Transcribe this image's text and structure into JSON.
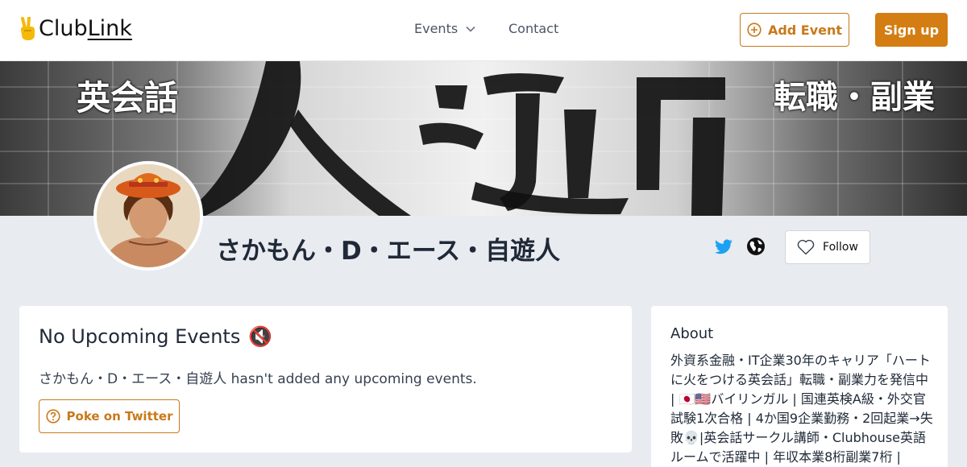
{
  "header": {
    "logo_prefix": "Club",
    "logo_suffix": "Link",
    "nav_events": "Events",
    "nav_contact": "Contact",
    "add_event": "Add Event",
    "sign_up": "Sign up"
  },
  "banner": {
    "left_text": "英会話",
    "right_text": "転職・副業"
  },
  "profile": {
    "name": "さかもん・D・エース・自遊人",
    "follow": "Follow"
  },
  "events": {
    "title": "No Upcoming Events",
    "title_emoji": "🔇",
    "description": "さかもん・D・エース・自遊人 hasn't added any upcoming events.",
    "poke_button": "Poke on Twitter"
  },
  "about": {
    "title": "About",
    "text": "外資系金融・IT企業30年のキャリア「ハートに火をつける英会話」転職・副業力を発信中 | 🇯🇵🇺🇸バイリンガル | 国連英検A級・外交官試験1次合格 | 4か国9企業勤務・2回起業→失敗💀|英会話サークル講師・Clubhouse英語ルームで活躍中 | 年収本業8桁副業7桁 |"
  },
  "colors": {
    "accent": "#d47d12",
    "accent_outline": "#c8791a",
    "twitter": "#1da1f2",
    "page_bg": "#e8ebf0"
  },
  "icons": {
    "logo": "victory-hand-icon",
    "events_chevron": "chevron-down-icon",
    "add_event": "plus-circle-icon",
    "twitter": "twitter-icon",
    "website": "globe-icon",
    "follow": "heart-icon",
    "poke": "question-circle-icon"
  }
}
